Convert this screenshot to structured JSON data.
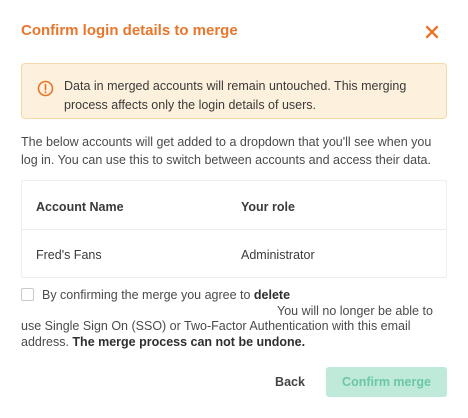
{
  "dialog": {
    "title": "Confirm login details to merge",
    "close_icon": "close-icon",
    "accent_color": "#e8762b"
  },
  "alert": {
    "icon": "warning-circle-icon",
    "text": "Data in merged accounts will remain untouched. This merging process affects only the login details of users."
  },
  "description": "The below accounts will get added to a dropdown that you'll see when you log in. You can use this to switch between accounts and access their data.",
  "table": {
    "headers": [
      "Account Name",
      "Your role"
    ],
    "rows": [
      [
        "Fred's Fans",
        "Administrator"
      ]
    ]
  },
  "consent": {
    "checked": false,
    "prefix": "By confirming the merge you agree to ",
    "bold_word": "delete",
    "line2": "You will no longer be able to",
    "line3": "use Single Sign On (SSO) or Two-Factor Authentication with this email address. ",
    "warning": "The merge process can not be undone."
  },
  "footer": {
    "back_label": "Back",
    "confirm_label": "Confirm merge",
    "confirm_disabled": true
  }
}
